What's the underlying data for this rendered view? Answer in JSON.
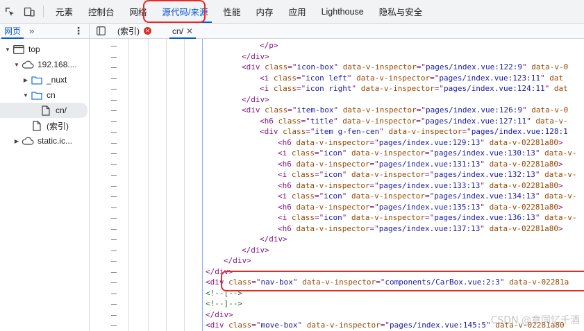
{
  "topbar": {
    "tabs": [
      {
        "label": "元素",
        "active": false
      },
      {
        "label": "控制台",
        "active": false
      },
      {
        "label": "网络",
        "active": false
      },
      {
        "label": "源代码/来源",
        "active": true
      },
      {
        "label": "性能",
        "active": false
      },
      {
        "label": "内存",
        "active": false
      },
      {
        "label": "应用",
        "active": false
      },
      {
        "label": "Lighthouse",
        "active": false
      },
      {
        "label": "隐私与安全",
        "active": false
      }
    ]
  },
  "navigator": {
    "tab_label": "网页",
    "more_label": "»",
    "tree": [
      {
        "label": "top",
        "depth": 0,
        "icon": "frame-icon",
        "expanded": true
      },
      {
        "label": "192.168....",
        "depth": 1,
        "icon": "cloud-icon",
        "expanded": true
      },
      {
        "label": "_nuxt",
        "depth": 2,
        "icon": "folder-icon",
        "expanded": false
      },
      {
        "label": "cn",
        "depth": 2,
        "icon": "folder-icon",
        "expanded": true
      },
      {
        "label": "cn/",
        "depth": 3,
        "icon": "file-icon",
        "selected": true
      },
      {
        "label": "(索引)",
        "depth": 2,
        "icon": "file-icon"
      },
      {
        "label": "static.ic...",
        "depth": 1,
        "icon": "cloud-icon",
        "expanded": false
      }
    ]
  },
  "editor": {
    "tabs": [
      {
        "label": "(索引)",
        "error": true
      },
      {
        "label": "cn/",
        "active": true
      }
    ],
    "lines": [
      {
        "indent": 80,
        "parts": [
          [
            "tag",
            "</p>"
          ]
        ]
      },
      {
        "indent": 54,
        "parts": [
          [
            "tag",
            "</div>"
          ]
        ]
      },
      {
        "indent": 54,
        "parts": [
          [
            "tag",
            "<div "
          ],
          [
            "an",
            "class"
          ],
          [
            "tag",
            "=\""
          ],
          [
            "av",
            "icon-box"
          ],
          [
            "tag",
            "\" "
          ],
          [
            "an",
            "data-v-inspector"
          ],
          [
            "tag",
            "=\""
          ],
          [
            "av",
            "pages/index.vue:122:9"
          ],
          [
            "tag",
            "\" "
          ],
          [
            "an",
            "data-v-0"
          ]
        ]
      },
      {
        "indent": 80,
        "parts": [
          [
            "tag",
            "<i "
          ],
          [
            "an",
            "class"
          ],
          [
            "tag",
            "=\""
          ],
          [
            "av",
            "icon left"
          ],
          [
            "tag",
            "\" "
          ],
          [
            "an",
            "data-v-inspector"
          ],
          [
            "tag",
            "=\""
          ],
          [
            "av",
            "pages/index.vue:123:11"
          ],
          [
            "tag",
            "\" "
          ],
          [
            "an",
            "dat"
          ]
        ]
      },
      {
        "indent": 80,
        "parts": [
          [
            "tag",
            "<i "
          ],
          [
            "an",
            "class"
          ],
          [
            "tag",
            "=\""
          ],
          [
            "av",
            "icon right"
          ],
          [
            "tag",
            "\" "
          ],
          [
            "an",
            "data-v-inspector"
          ],
          [
            "tag",
            "=\""
          ],
          [
            "av",
            "pages/index.vue:124:11"
          ],
          [
            "tag",
            "\" "
          ],
          [
            "an",
            "dat"
          ]
        ]
      },
      {
        "indent": 54,
        "parts": [
          [
            "tag",
            "</div>"
          ]
        ]
      },
      {
        "indent": 54,
        "parts": [
          [
            "tag",
            "<div "
          ],
          [
            "an",
            "class"
          ],
          [
            "tag",
            "=\""
          ],
          [
            "av",
            "item-box"
          ],
          [
            "tag",
            "\" "
          ],
          [
            "an",
            "data-v-inspector"
          ],
          [
            "tag",
            "=\""
          ],
          [
            "av",
            "pages/index.vue:126:9"
          ],
          [
            "tag",
            "\" "
          ],
          [
            "an",
            "data-v-0"
          ]
        ]
      },
      {
        "indent": 80,
        "parts": [
          [
            "tag",
            "<h6 "
          ],
          [
            "an",
            "class"
          ],
          [
            "tag",
            "=\""
          ],
          [
            "av",
            "title"
          ],
          [
            "tag",
            "\" "
          ],
          [
            "an",
            "data-v-inspector"
          ],
          [
            "tag",
            "=\""
          ],
          [
            "av",
            "pages/index.vue:127:11"
          ],
          [
            "tag",
            "\" "
          ],
          [
            "an",
            "data-v-"
          ]
        ]
      },
      {
        "indent": 80,
        "parts": [
          [
            "tag",
            "<div "
          ],
          [
            "an",
            "class"
          ],
          [
            "tag",
            "=\""
          ],
          [
            "av",
            "item g-fen-cen"
          ],
          [
            "tag",
            "\" "
          ],
          [
            "an",
            "data-v-inspector"
          ],
          [
            "tag",
            "=\""
          ],
          [
            "av",
            "pages/index.vue:128:1"
          ]
        ]
      },
      {
        "indent": 106,
        "parts": [
          [
            "tag",
            "<h6 "
          ],
          [
            "an",
            "data-v-inspector"
          ],
          [
            "tag",
            "=\""
          ],
          [
            "av",
            "pages/index.vue:129:13"
          ],
          [
            "tag",
            "\" "
          ],
          [
            "an",
            "data-v-02281a80"
          ],
          [
            "tag",
            ">"
          ]
        ]
      },
      {
        "indent": 106,
        "parts": [
          [
            "tag",
            "<i "
          ],
          [
            "an",
            "class"
          ],
          [
            "tag",
            "=\""
          ],
          [
            "av",
            "icon"
          ],
          [
            "tag",
            "\" "
          ],
          [
            "an",
            "data-v-inspector"
          ],
          [
            "tag",
            "=\""
          ],
          [
            "av",
            "pages/index.vue:130:13"
          ],
          [
            "tag",
            "\" "
          ],
          [
            "an",
            "data-v-"
          ]
        ]
      },
      {
        "indent": 106,
        "parts": [
          [
            "tag",
            "<h6 "
          ],
          [
            "an",
            "data-v-inspector"
          ],
          [
            "tag",
            "=\""
          ],
          [
            "av",
            "pages/index.vue:131:13"
          ],
          [
            "tag",
            "\" "
          ],
          [
            "an",
            "data-v-02281a80"
          ],
          [
            "tag",
            ">"
          ]
        ]
      },
      {
        "indent": 106,
        "parts": [
          [
            "tag",
            "<i "
          ],
          [
            "an",
            "class"
          ],
          [
            "tag",
            "=\""
          ],
          [
            "av",
            "icon"
          ],
          [
            "tag",
            "\" "
          ],
          [
            "an",
            "data-v-inspector"
          ],
          [
            "tag",
            "=\""
          ],
          [
            "av",
            "pages/index.vue:132:13"
          ],
          [
            "tag",
            "\" "
          ],
          [
            "an",
            "data-v-"
          ]
        ]
      },
      {
        "indent": 106,
        "parts": [
          [
            "tag",
            "<h6 "
          ],
          [
            "an",
            "data-v-inspector"
          ],
          [
            "tag",
            "=\""
          ],
          [
            "av",
            "pages/index.vue:133:13"
          ],
          [
            "tag",
            "\" "
          ],
          [
            "an",
            "data-v-02281a80"
          ],
          [
            "tag",
            ">"
          ]
        ]
      },
      {
        "indent": 106,
        "parts": [
          [
            "tag",
            "<i "
          ],
          [
            "an",
            "class"
          ],
          [
            "tag",
            "=\""
          ],
          [
            "av",
            "icon"
          ],
          [
            "tag",
            "\" "
          ],
          [
            "an",
            "data-v-inspector"
          ],
          [
            "tag",
            "=\""
          ],
          [
            "av",
            "pages/index.vue:134:13"
          ],
          [
            "tag",
            "\" "
          ],
          [
            "an",
            "data-v-"
          ]
        ]
      },
      {
        "indent": 106,
        "parts": [
          [
            "tag",
            "<h6 "
          ],
          [
            "an",
            "data-v-inspector"
          ],
          [
            "tag",
            "=\""
          ],
          [
            "av",
            "pages/index.vue:135:13"
          ],
          [
            "tag",
            "\" "
          ],
          [
            "an",
            "data-v-02281a80"
          ],
          [
            "tag",
            ">"
          ]
        ]
      },
      {
        "indent": 106,
        "parts": [
          [
            "tag",
            "<i "
          ],
          [
            "an",
            "class"
          ],
          [
            "tag",
            "=\""
          ],
          [
            "av",
            "icon"
          ],
          [
            "tag",
            "\" "
          ],
          [
            "an",
            "data-v-inspector"
          ],
          [
            "tag",
            "=\""
          ],
          [
            "av",
            "pages/index.vue:136:13"
          ],
          [
            "tag",
            "\" "
          ],
          [
            "an",
            "data-v-"
          ]
        ]
      },
      {
        "indent": 106,
        "parts": [
          [
            "tag",
            "<h6 "
          ],
          [
            "an",
            "data-v-inspector"
          ],
          [
            "tag",
            "=\""
          ],
          [
            "av",
            "pages/index.vue:137:13"
          ],
          [
            "tag",
            "\" "
          ],
          [
            "an",
            "data-v-02281a80"
          ],
          [
            "tag",
            ">"
          ]
        ]
      },
      {
        "indent": 80,
        "parts": [
          [
            "tag",
            "</div>"
          ]
        ]
      },
      {
        "indent": 54,
        "parts": [
          [
            "tag",
            "</div>"
          ]
        ]
      },
      {
        "indent": 28,
        "parts": [
          [
            "tag",
            "</div>"
          ]
        ]
      },
      {
        "indent": 2,
        "parts": [
          [
            "tag",
            "</div>"
          ]
        ]
      },
      {
        "indent": 2,
        "parts": [
          [
            "tag",
            "<div "
          ],
          [
            "an",
            "class"
          ],
          [
            "tag",
            "=\""
          ],
          [
            "av",
            "nav-box"
          ],
          [
            "tag",
            "\" "
          ],
          [
            "an",
            "data-v-inspector"
          ],
          [
            "tag",
            "=\""
          ],
          [
            "av",
            "components/CarBox.vue:2:3"
          ],
          [
            "tag",
            "\" "
          ],
          [
            "an",
            "data-v-02281a"
          ]
        ]
      },
      {
        "indent": 2,
        "parts": [
          [
            "cm",
            "<!--[-->"
          ]
        ]
      },
      {
        "indent": 2,
        "parts": [
          [
            "cm",
            "<!--]-->"
          ]
        ]
      },
      {
        "indent": 2,
        "parts": [
          [
            "tag",
            "</div>"
          ]
        ]
      },
      {
        "indent": 2,
        "parts": [
          [
            "tag",
            "<div "
          ],
          [
            "an",
            "class"
          ],
          [
            "tag",
            "=\""
          ],
          [
            "av",
            "move-box"
          ],
          [
            "tag",
            "\" "
          ],
          [
            "an",
            "data-v-inspector"
          ],
          [
            "tag",
            "=\""
          ],
          [
            "av",
            "pages/index.vue:145:5"
          ],
          [
            "tag",
            "\" "
          ],
          [
            "an",
            "data-v-02281a80"
          ]
        ]
      }
    ]
  },
  "watermark": "CSDN @意同忆千酒",
  "colors": {
    "accent": "#0b57d0",
    "highlight_red": "#e32a2a"
  }
}
